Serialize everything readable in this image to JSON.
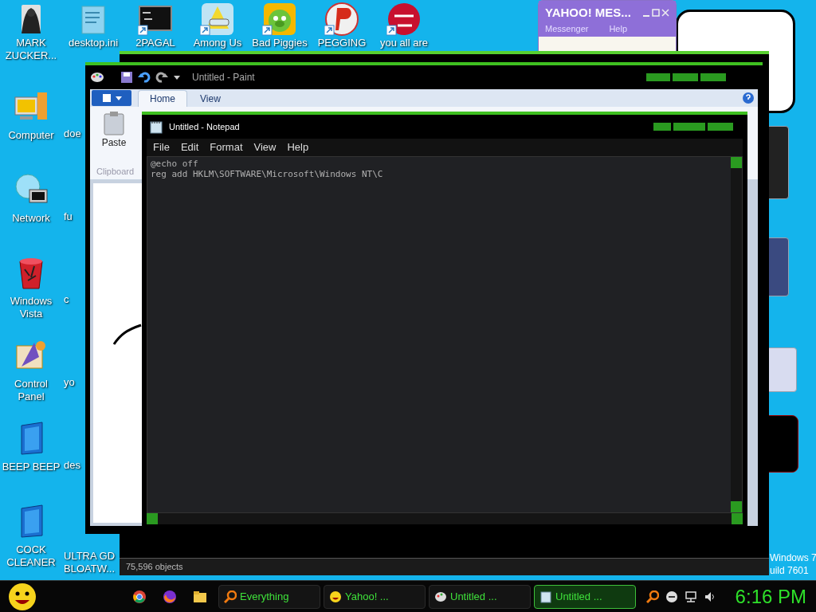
{
  "desktop": {
    "top_row": [
      {
        "label": "MARK ZUCKER...",
        "kind": "book"
      },
      {
        "label": "desktop.ini",
        "kind": "document"
      },
      {
        "label": "2PAGAL",
        "kind": "console"
      },
      {
        "label": "Among Us",
        "kind": "tile"
      },
      {
        "label": "Bad Piggies",
        "kind": "game"
      },
      {
        "label": "PEGGING",
        "kind": "round"
      },
      {
        "label": "you all are",
        "kind": "dev"
      }
    ],
    "column_1": [
      {
        "label": "Computer",
        "kind": "computer"
      },
      {
        "label": "Network",
        "kind": "globe"
      },
      {
        "label": "Windows Vista",
        "kind": "bin"
      },
      {
        "label": "Control Panel",
        "kind": "panel"
      },
      {
        "label": "BEEP BEEP",
        "kind": "device"
      },
      {
        "label": "COCK CLEANER",
        "kind": "device"
      }
    ],
    "column_2": [
      {
        "label": "doe"
      },
      {
        "label": "fu"
      },
      {
        "label": "c"
      },
      {
        "label": "yo"
      },
      {
        "label": "des"
      },
      {
        "label": "ULTRA GD BLOATW..."
      }
    ],
    "os_build": [
      "Windows 7",
      "uild 7601"
    ]
  },
  "messenger": {
    "title": "YAHOO! MES...",
    "menu": [
      "Messenger",
      "Help"
    ]
  },
  "explorer": {
    "status": "75,596 objects"
  },
  "paint": {
    "title": "Untitled - Paint",
    "tabs": [
      {
        "label": "Home",
        "selected": true
      },
      {
        "label": "View",
        "selected": false
      }
    ],
    "paste": "Paste",
    "group": "Clipboard"
  },
  "notepad": {
    "title": "Untitled - Notepad",
    "menu": [
      "File",
      "Edit",
      "Format",
      "View",
      "Help"
    ],
    "lines": [
      "@echo off",
      "reg add HKLM\\SOFTWARE\\Microsoft\\Windows NT\\C"
    ]
  },
  "taskbar": {
    "pinned": [
      {
        "kind": "chrome"
      },
      {
        "kind": "firefox"
      },
      {
        "kind": "folder"
      }
    ],
    "tasks": [
      {
        "label": "Everything",
        "kind": "search",
        "selected": false
      },
      {
        "label": "Yahoo! ...",
        "kind": "smiley",
        "selected": false
      },
      {
        "label": "Untitled ...",
        "kind": "paint",
        "selected": false
      },
      {
        "label": "Untitled ...",
        "kind": "notepad",
        "selected": true
      }
    ],
    "clock": "6:16 PM"
  }
}
